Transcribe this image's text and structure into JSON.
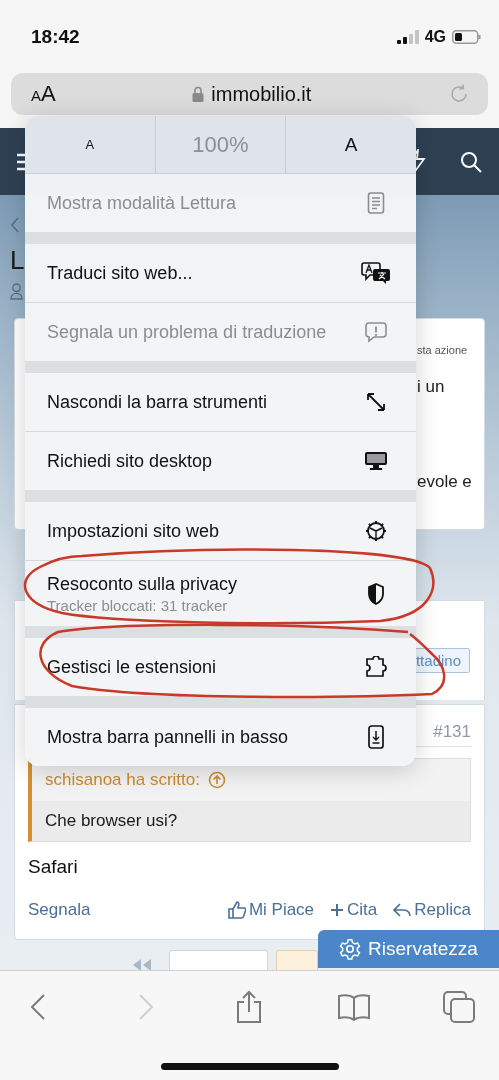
{
  "status_bar": {
    "time": "18:42",
    "network": "4G"
  },
  "address_bar": {
    "text_size_button": "AA",
    "url": "immobilio.it"
  },
  "page": {
    "title": "L",
    "card_fragments": [
      "sta azione",
      "i un",
      "evole e"
    ],
    "badge": "ttadino",
    "post": {
      "number": "#131",
      "quote_author": "schisanoa ha scritto:",
      "quote_text": "Che browser usi?",
      "body": "Safari",
      "actions": [
        {
          "label": "Segnala",
          "kind": "report"
        },
        {
          "label": "Mi Piace",
          "kind": "like"
        },
        {
          "label": "Cita",
          "kind": "quote"
        },
        {
          "label": "Replica",
          "kind": "reply"
        }
      ]
    },
    "privacy_button": "Riservatezza"
  },
  "menu": {
    "text_size": {
      "decrease": "A",
      "zoom": "100%",
      "increase": "A"
    },
    "groups": [
      {
        "items": [
          {
            "label": "Mostra modalità Lettura",
            "kind": "reader",
            "disabled": true
          }
        ]
      },
      {
        "items": [
          {
            "label": "Traduci sito web...",
            "kind": "translate",
            "disabled": false
          },
          {
            "label": "Segnala un problema di traduzione",
            "kind": "report",
            "disabled": true
          }
        ]
      },
      {
        "items": [
          {
            "label": "Nascondi la barra strumenti",
            "kind": "resize",
            "disabled": false
          },
          {
            "label": "Richiedi sito desktop",
            "kind": "desktop",
            "disabled": false
          }
        ]
      },
      {
        "items": [
          {
            "label": "Impostazioni sito web",
            "kind": "settings",
            "disabled": false
          },
          {
            "label": "Resoconto sulla privacy",
            "subtitle": "Tracker bloccati: 31 tracker",
            "kind": "privacy",
            "disabled": false
          }
        ]
      },
      {
        "items": [
          {
            "label": "Gestisci le estensioni",
            "kind": "extensions",
            "disabled": false
          }
        ]
      },
      {
        "items": [
          {
            "label": "Mostra barra pannelli in basso",
            "kind": "tabbar",
            "disabled": false
          }
        ]
      }
    ]
  },
  "toolbar": [
    {
      "kind": "back",
      "disabled": false
    },
    {
      "kind": "forward",
      "disabled": true
    },
    {
      "kind": "share",
      "disabled": false
    },
    {
      "kind": "bookmarks",
      "disabled": false
    },
    {
      "kind": "tabs",
      "disabled": false
    }
  ]
}
